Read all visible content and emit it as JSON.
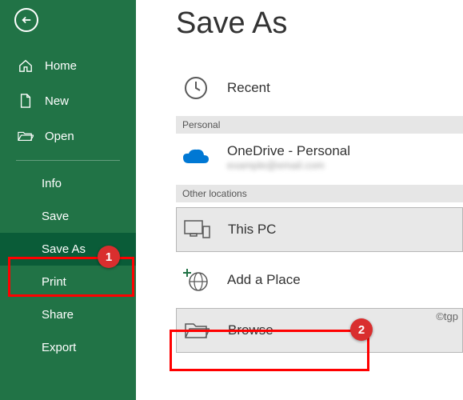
{
  "sidebar": {
    "home": "Home",
    "new": "New",
    "open": "Open",
    "info": "Info",
    "save": "Save",
    "saveAs": "Save As",
    "print": "Print",
    "share": "Share",
    "export": "Export"
  },
  "page": {
    "title": "Save As"
  },
  "locations": {
    "recent": "Recent",
    "personalHeader": "Personal",
    "onedrive": "OneDrive - Personal",
    "onedriveSub": "example@email.com",
    "otherHeader": "Other locations",
    "thisPC": "This PC",
    "addPlace": "Add a Place",
    "browse": "Browse"
  },
  "markers": {
    "one": "1",
    "two": "2"
  },
  "watermark": "©tgp"
}
